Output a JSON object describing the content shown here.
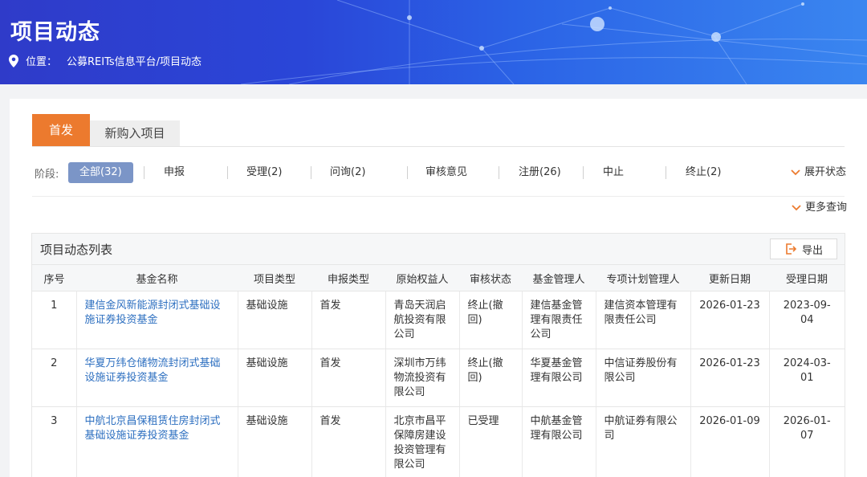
{
  "header": {
    "title": "项目动态",
    "location_label": "位置：",
    "breadcrumb": "公募REITs信息平台/项目动态"
  },
  "tabs": [
    {
      "label": "首发",
      "active": true
    },
    {
      "label": "新购入项目",
      "active": false
    }
  ],
  "stages": {
    "label": "阶段:",
    "items": [
      "全部(32)",
      "申报",
      "受理(2)",
      "问询(2)",
      "审核意见",
      "注册(26)",
      "中止",
      "终止(2)"
    ],
    "selected": "全部(32)",
    "expand_label": "展开状态",
    "more_query_label": "更多查询"
  },
  "list": {
    "title": "项目动态列表",
    "export_label": "导出",
    "columns": [
      "序号",
      "基金名称",
      "项目类型",
      "申报类型",
      "原始权益人",
      "审核状态",
      "基金管理人",
      "专项计划管理人",
      "更新日期",
      "受理日期"
    ],
    "rows": [
      [
        "1",
        "建信金风新能源封闭式基础设施证券投资基金",
        "基础设施",
        "首发",
        "青岛天润启航投资有限公司",
        "终止(撤回)",
        "建信基金管理有限责任公司",
        "建信资本管理有限责任公司",
        "2026-01-23",
        "2023-09-04"
      ],
      [
        "2",
        "华夏万纬仓储物流封闭式基础设施证券投资基金",
        "基础设施",
        "首发",
        "深圳市万纬物流投资有限公司",
        "终止(撤回)",
        "华夏基金管理有限公司",
        "中信证券股份有限公司",
        "2026-01-23",
        "2024-03-01"
      ],
      [
        "3",
        "中航北京昌保租赁住房封闭式基础设施证券投资基金",
        "基础设施",
        "首发",
        "北京市昌平保障房建设投资管理有限公司",
        "已受理",
        "中航基金管理有限公司",
        "中航证券有限公司",
        "2026-01-09",
        "2026-01-07"
      ]
    ]
  },
  "colors": {
    "accent": "#ec7a2e",
    "link": "#2d6fc0",
    "stage_active": "#7b95c7"
  }
}
